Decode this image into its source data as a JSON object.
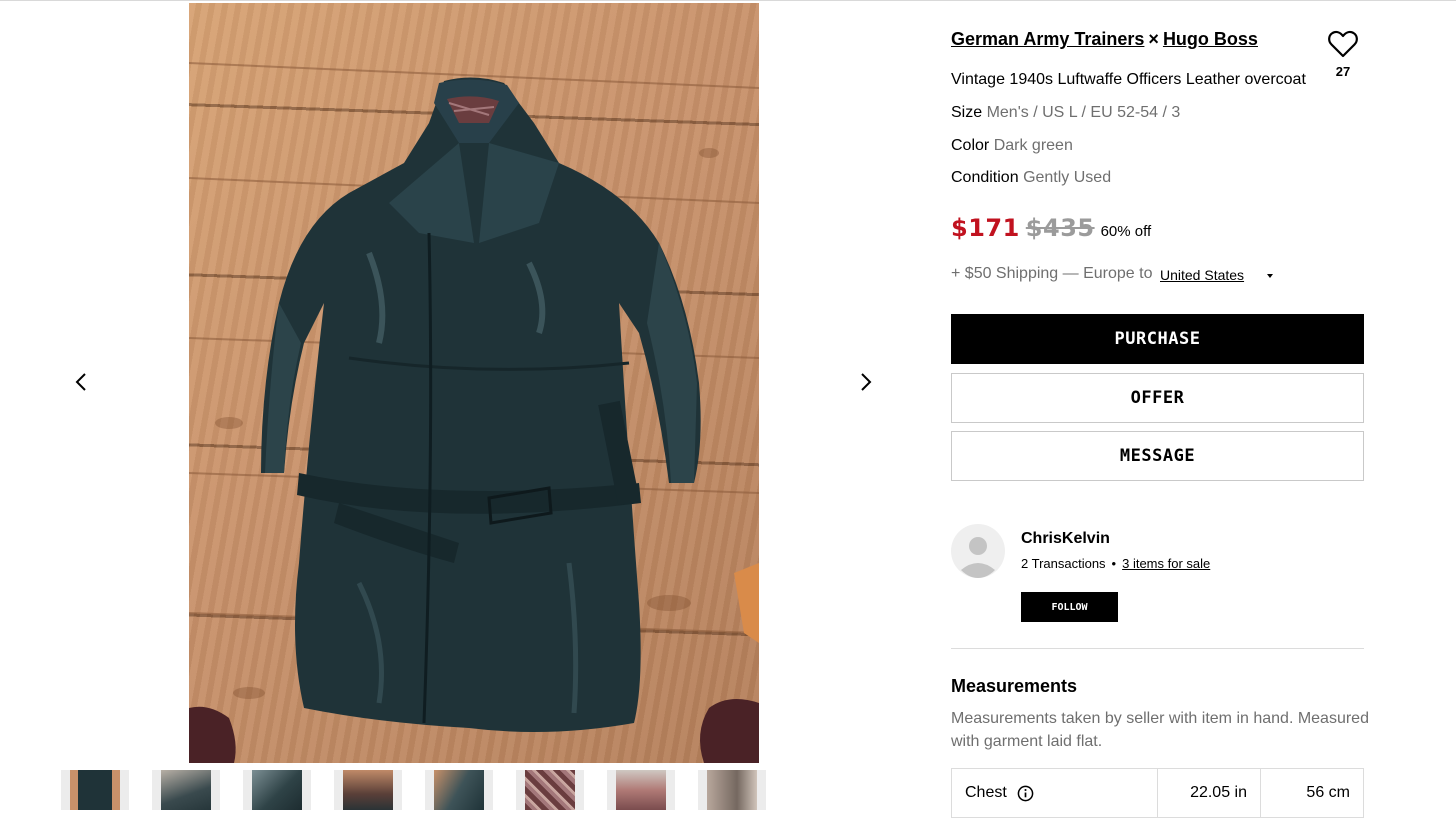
{
  "listing": {
    "designer_1": "German Army Trainers",
    "designer_sep": "×",
    "designer_2": "Hugo Boss",
    "title": "Vintage 1940s Luftwaffe Officers Leather overcoat",
    "likes": "27",
    "size_label": "Size",
    "size_value": "Men's / US L / EU 52-54 / 3",
    "color_label": "Color",
    "color_value": "Dark green",
    "condition_label": "Condition",
    "condition_value": "Gently Used"
  },
  "price": {
    "current": "$171",
    "original": "$435",
    "discount": "60% off"
  },
  "shipping": {
    "text": "+ $50 Shipping — Europe to",
    "country": "United States"
  },
  "actions": {
    "purchase": "PURCHASE",
    "offer": "OFFER",
    "message": "MESSAGE"
  },
  "seller": {
    "name": "ChrisKelvin",
    "transactions": "2 Transactions",
    "separator": "•",
    "items_for_sale": "3 items for sale",
    "follow": "FOLLOW"
  },
  "measurements": {
    "title": "Measurements",
    "description": "Measurements taken by seller with item in hand. Measured with garment laid flat.",
    "rows": [
      {
        "label": "Chest",
        "inches": "22.05 in",
        "cm": "56 cm"
      }
    ]
  },
  "gallery": {
    "thumbnail_count": 8,
    "icons": [
      "chevron-left-icon",
      "chevron-right-icon",
      "heart-icon",
      "info-icon",
      "caret-down-icon"
    ]
  },
  "colors": {
    "price_red": "#c1121f",
    "strike_gray": "#9b9b9b",
    "muted_text": "#6f6f6f",
    "primary_button": "#000000",
    "coat_leather": "#1f3338",
    "floor_wood": "#c8916a"
  }
}
